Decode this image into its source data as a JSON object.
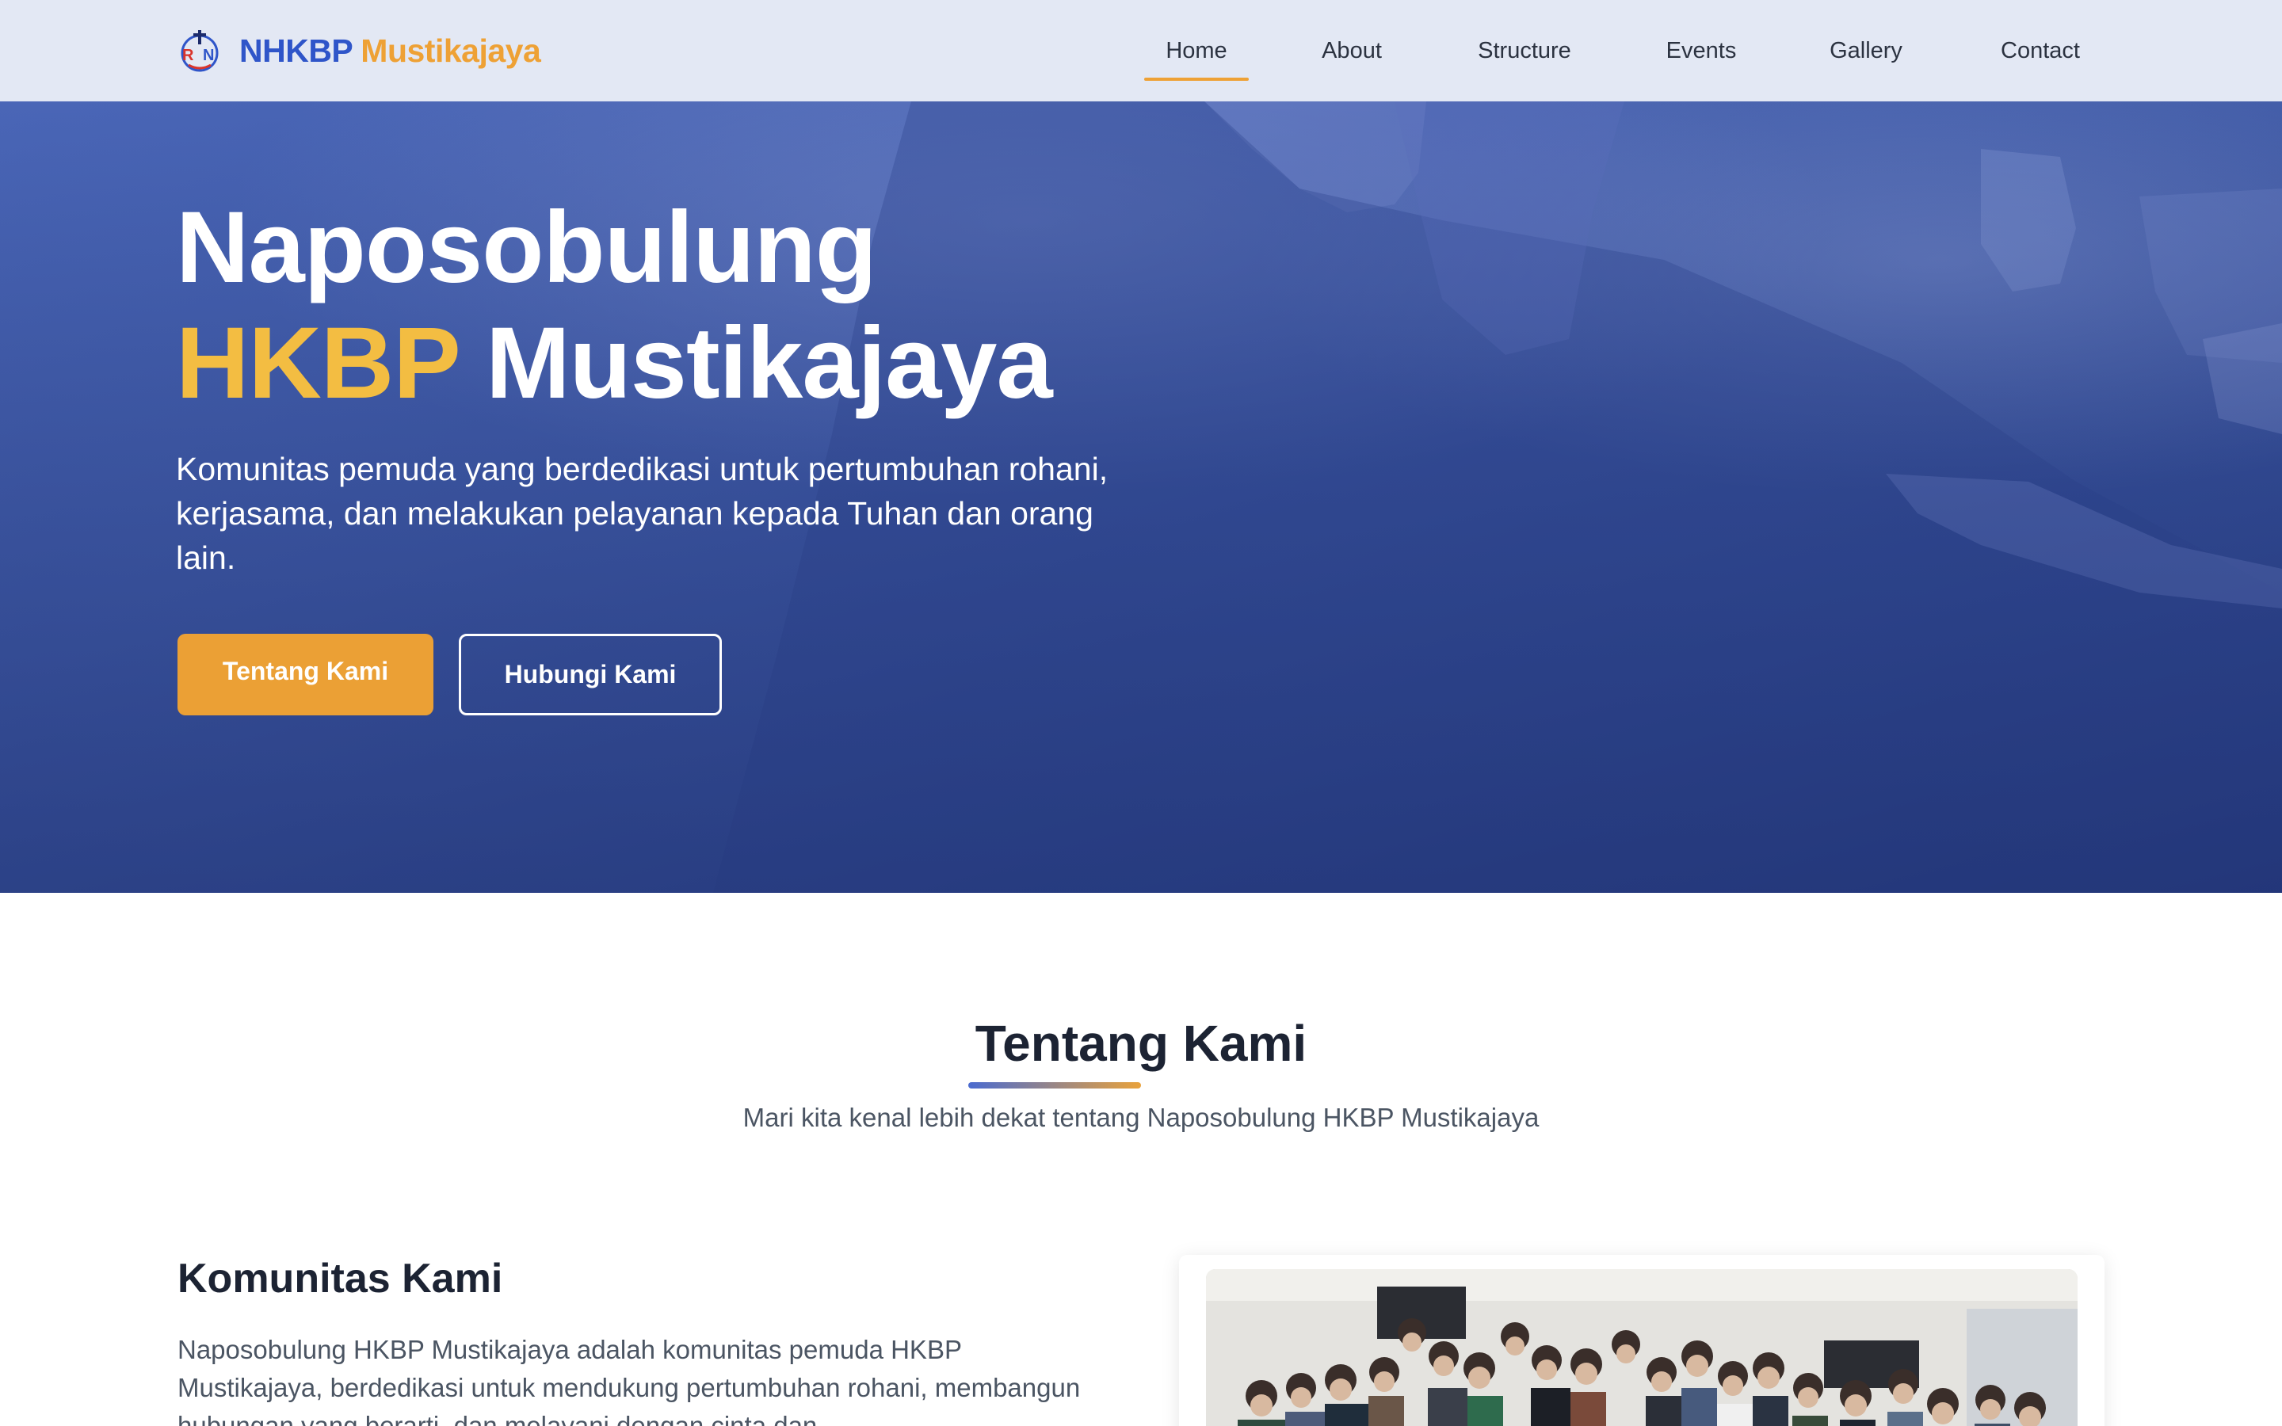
{
  "brand": {
    "name_part1": "NHKBP",
    "name_part2": "Mustikajaya",
    "logo_icon": "rdn-logo-icon",
    "color_primary": "#2f55c9",
    "color_accent": "#eea135"
  },
  "nav": {
    "items": [
      {
        "label": "Home",
        "active": true
      },
      {
        "label": "About",
        "active": false
      },
      {
        "label": "Structure",
        "active": false
      },
      {
        "label": "Events",
        "active": false
      },
      {
        "label": "Gallery",
        "active": false
      },
      {
        "label": "Contact",
        "active": false
      }
    ]
  },
  "hero": {
    "title_line1": "Naposobulung",
    "title_highlight": "HKBP",
    "title_rest": "Mustikajaya",
    "subtitle": "Komunitas pemuda yang berdedikasi untuk pertumbuhan rohani, kerjasama, dan melakukan pelayanan kepada Tuhan dan orang lain.",
    "primary_button": "Tentang Kami",
    "secondary_button": "Hubungi Kami",
    "background_color": "#3f5aa7",
    "highlight_color": "#f3bd42"
  },
  "about": {
    "title": "Tentang Kami",
    "subtitle": "Mari kita kenal lebih dekat tentang Naposobulung HKBP Mustikajaya",
    "heading": "Komunitas Kami",
    "text": "Naposobulung HKBP Mustikajaya adalah komunitas pemuda HKBP Mustikajaya, berdedikasi untuk mendukung pertumbuhan rohani, membangun hubungan yang berarti, dan melayani dengan cinta dan"
  }
}
